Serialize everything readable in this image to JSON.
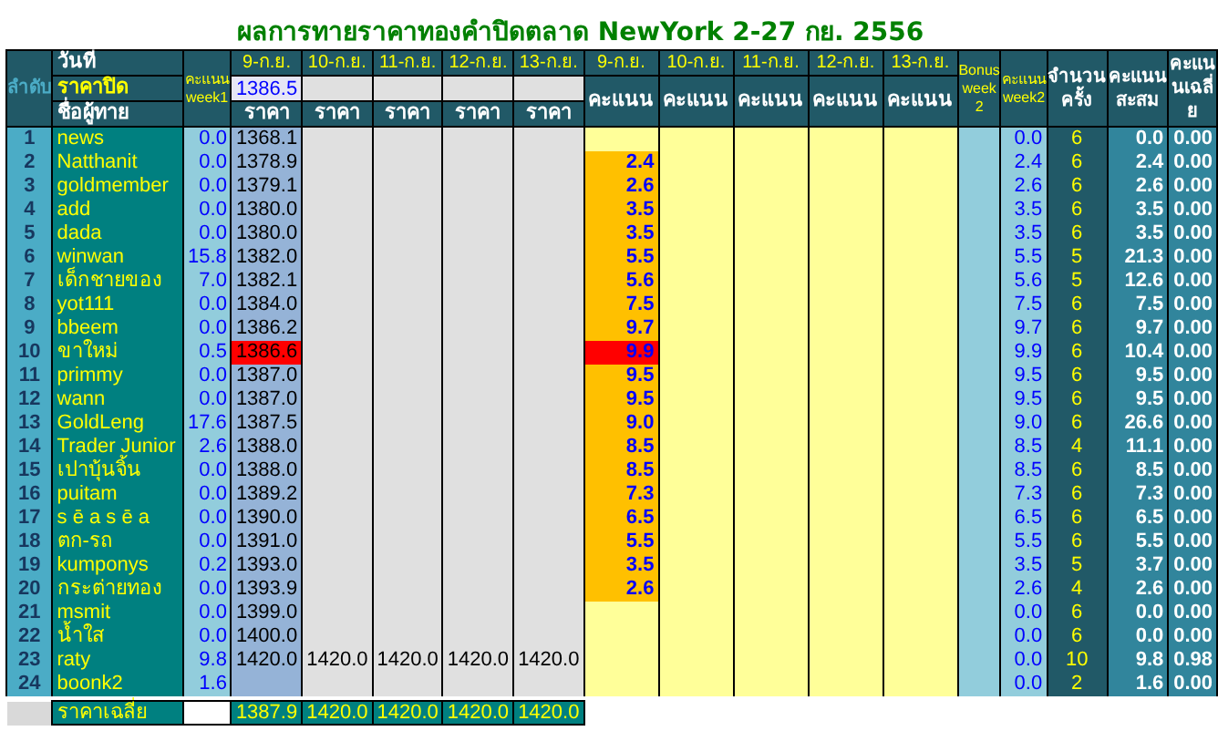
{
  "title": "ผลการทายราคาทองคำปิดตลาด NewYork 2-27 กย. 2556",
  "header": {
    "rank": "ลำดับ",
    "date_label": "วันที่",
    "close_label": "ราคาปิด",
    "name_label": "ชื่อผู้ทาย",
    "week1": "คะแนน week1",
    "price_dates": [
      "9-ก.ย.",
      "10-ก.ย.",
      "11-ก.ย.",
      "12-ก.ย.",
      "13-ก.ย."
    ],
    "close_prices": [
      "1386.5"
    ],
    "price_labels": [
      "ราคา",
      "ราคา",
      "ราคา",
      "ราคา",
      "ราคา"
    ],
    "score_dates": [
      "9-ก.ย.",
      "10-ก.ย.",
      "11-ก.ย.",
      "12-ก.ย.",
      "13-ก.ย."
    ],
    "score_labels": [
      "คะแนน",
      "คะแนน",
      "คะแนน",
      "คะแนน",
      "คะแนน"
    ],
    "bonus": "Bonus week 2",
    "week2": "คะแนน week2",
    "count": "จำนวนครั้ง",
    "total": "คะแนนสะสม",
    "average": "คะแนนเฉลี่ย"
  },
  "rows": [
    {
      "rank": "1",
      "name": "news",
      "week1": "0.0",
      "prices": [
        "1368.1"
      ],
      "scores": [],
      "highlighted": false,
      "week2": "0.0",
      "count": "6",
      "total": "0.0",
      "average": "0.00"
    },
    {
      "rank": "2",
      "name": "Natthanit",
      "week1": "0.0",
      "prices": [
        "1378.9"
      ],
      "scores": [
        "2.4"
      ],
      "highlighted": false,
      "week2": "2.4",
      "count": "6",
      "total": "2.4",
      "average": "0.00"
    },
    {
      "rank": "3",
      "name": "goldmember",
      "week1": "0.0",
      "prices": [
        "1379.1"
      ],
      "scores": [
        "2.6"
      ],
      "highlighted": false,
      "week2": "2.6",
      "count": "6",
      "total": "2.6",
      "average": "0.00"
    },
    {
      "rank": "4",
      "name": "add",
      "week1": "0.0",
      "prices": [
        "1380.0"
      ],
      "scores": [
        "3.5"
      ],
      "highlighted": false,
      "week2": "3.5",
      "count": "6",
      "total": "3.5",
      "average": "0.00"
    },
    {
      "rank": "5",
      "name": "dada",
      "week1": "0.0",
      "prices": [
        "1380.0"
      ],
      "scores": [
        "3.5"
      ],
      "highlighted": false,
      "week2": "3.5",
      "count": "6",
      "total": "3.5",
      "average": "0.00"
    },
    {
      "rank": "6",
      "name": "winwan",
      "week1": "15.8",
      "prices": [
        "1382.0"
      ],
      "scores": [
        "5.5"
      ],
      "highlighted": false,
      "week2": "5.5",
      "count": "5",
      "total": "21.3",
      "average": "0.00"
    },
    {
      "rank": "7",
      "name": "เด็กชายของ",
      "week1": "7.0",
      "prices": [
        "1382.1"
      ],
      "scores": [
        "5.6"
      ],
      "highlighted": false,
      "week2": "5.6",
      "count": "5",
      "total": "12.6",
      "average": "0.00"
    },
    {
      "rank": "8",
      "name": "yot111",
      "week1": "0.0",
      "prices": [
        "1384.0"
      ],
      "scores": [
        "7.5"
      ],
      "highlighted": false,
      "week2": "7.5",
      "count": "6",
      "total": "7.5",
      "average": "0.00"
    },
    {
      "rank": "9",
      "name": "bbeem",
      "week1": "0.0",
      "prices": [
        "1386.2"
      ],
      "scores": [
        "9.7"
      ],
      "highlighted": false,
      "week2": "9.7",
      "count": "6",
      "total": "9.7",
      "average": "0.00"
    },
    {
      "rank": "10",
      "name": "ขาใหม่",
      "week1": "0.5",
      "prices": [
        "1386.6"
      ],
      "scores": [
        "9.9"
      ],
      "highlighted": true,
      "week2": "9.9",
      "count": "6",
      "total": "10.4",
      "average": "0.00"
    },
    {
      "rank": "11",
      "name": "primmy",
      "week1": "0.0",
      "prices": [
        "1387.0"
      ],
      "scores": [
        "9.5"
      ],
      "highlighted": false,
      "week2": "9.5",
      "count": "6",
      "total": "9.5",
      "average": "0.00"
    },
    {
      "rank": "12",
      "name": "wann",
      "week1": "0.0",
      "prices": [
        "1387.0"
      ],
      "scores": [
        "9.5"
      ],
      "highlighted": false,
      "week2": "9.5",
      "count": "6",
      "total": "9.5",
      "average": "0.00"
    },
    {
      "rank": "13",
      "name": "GoldLeng",
      "week1": "17.6",
      "prices": [
        "1387.5"
      ],
      "scores": [
        "9.0"
      ],
      "highlighted": false,
      "week2": "9.0",
      "count": "6",
      "total": "26.6",
      "average": "0.00"
    },
    {
      "rank": "14",
      "name": "Trader Junior",
      "week1": "2.6",
      "prices": [
        "1388.0"
      ],
      "scores": [
        "8.5"
      ],
      "highlighted": false,
      "week2": "8.5",
      "count": "4",
      "total": "11.1",
      "average": "0.00"
    },
    {
      "rank": "15",
      "name": "เปาบุ้นจิ้น",
      "week1": "0.0",
      "prices": [
        "1388.0"
      ],
      "scores": [
        "8.5"
      ],
      "highlighted": false,
      "week2": "8.5",
      "count": "6",
      "total": "8.5",
      "average": "0.00"
    },
    {
      "rank": "16",
      "name": "puitam",
      "week1": "0.0",
      "prices": [
        "1389.2"
      ],
      "scores": [
        "7.3"
      ],
      "highlighted": false,
      "week2": "7.3",
      "count": "6",
      "total": "7.3",
      "average": "0.00"
    },
    {
      "rank": "17",
      "name": "s ē a s ē a",
      "week1": "0.0",
      "prices": [
        "1390.0"
      ],
      "scores": [
        "6.5"
      ],
      "highlighted": false,
      "week2": "6.5",
      "count": "6",
      "total": "6.5",
      "average": "0.00"
    },
    {
      "rank": "18",
      "name": "ตก-รถ",
      "week1": "0.0",
      "prices": [
        "1391.0"
      ],
      "scores": [
        "5.5"
      ],
      "highlighted": false,
      "week2": "5.5",
      "count": "6",
      "total": "5.5",
      "average": "0.00"
    },
    {
      "rank": "19",
      "name": "kumponys",
      "week1": "0.2",
      "prices": [
        "1393.0"
      ],
      "scores": [
        "3.5"
      ],
      "highlighted": false,
      "week2": "3.5",
      "count": "5",
      "total": "3.7",
      "average": "0.00"
    },
    {
      "rank": "20",
      "name": "กระต่ายทอง",
      "week1": "0.0",
      "prices": [
        "1393.9"
      ],
      "scores": [
        "2.6"
      ],
      "highlighted": false,
      "week2": "2.6",
      "count": "4",
      "total": "2.6",
      "average": "0.00"
    },
    {
      "rank": "21",
      "name": "msmit",
      "week1": "0.0",
      "prices": [
        "1399.0"
      ],
      "scores": [],
      "highlighted": false,
      "week2": "0.0",
      "count": "6",
      "total": "0.0",
      "average": "0.00"
    },
    {
      "rank": "22",
      "name": "น้ำใส",
      "week1": "0.0",
      "prices": [
        "1400.0"
      ],
      "scores": [],
      "highlighted": false,
      "week2": "0.0",
      "count": "6",
      "total": "0.0",
      "average": "0.00"
    },
    {
      "rank": "23",
      "name": "raty",
      "week1": "9.8",
      "prices": [
        "1420.0",
        "1420.0",
        "1420.0",
        "1420.0",
        "1420.0"
      ],
      "scores": [],
      "highlighted": false,
      "week2": "0.0",
      "count": "10",
      "total": "9.8",
      "average": "0.98"
    },
    {
      "rank": "24",
      "name": "boonk2",
      "week1": "1.6",
      "prices": [],
      "scores": [],
      "highlighted": false,
      "week2": "0.0",
      "count": "2",
      "total": "1.6",
      "average": "0.00"
    }
  ],
  "footer": {
    "label": "ราคาเฉลี่ย",
    "values": [
      "1387.9",
      "1420.0",
      "1420.0",
      "1420.0",
      "1420.0"
    ]
  }
}
